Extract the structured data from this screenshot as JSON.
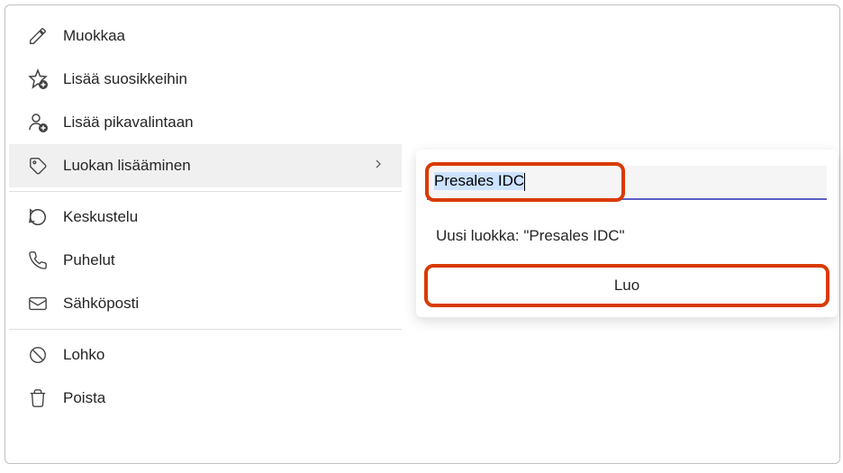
{
  "menu": {
    "edit": "Muokkaa",
    "add_favorites": "Lisää suosikkeihin",
    "add_speeddial": "Lisää pikavalintaan",
    "add_category": "Luokan lisääminen",
    "chat": "Keskustelu",
    "calls": "Puhelut",
    "email": "Sähköposti",
    "block": "Lohko",
    "delete": "Poista"
  },
  "submenu": {
    "input_value": "Presales IDC",
    "new_label": "Uusi luokka: \"Presales IDC\"",
    "create_button": "Luo"
  }
}
